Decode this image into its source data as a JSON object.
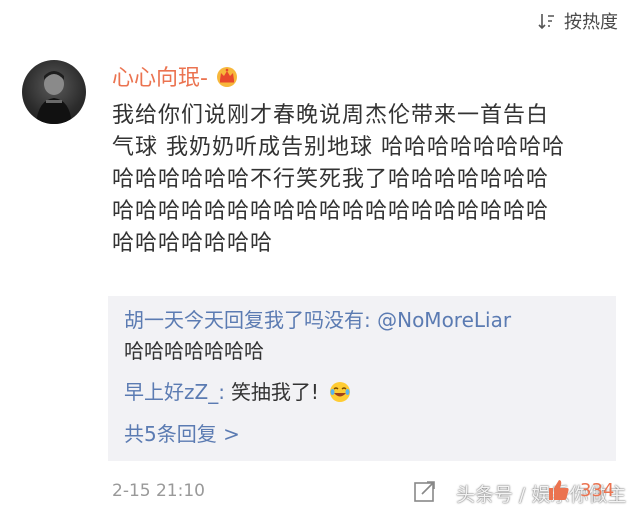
{
  "sort": {
    "label": "按热度",
    "icon": "sort-icon"
  },
  "comment": {
    "username": "心心向珉-",
    "badge_icon": "crown-icon",
    "avatar": "avatar",
    "text_lines": [
      "我给你们说刚才春晚说周杰伦带来一首告白",
      "气球 我奶奶听成告别地球 哈哈哈哈哈哈哈哈",
      "哈哈哈哈哈哈不行笑死我了哈哈哈哈哈哈哈",
      "哈哈哈哈哈哈哈哈哈哈哈哈哈哈哈哈哈哈哈",
      "哈哈哈哈哈哈哈"
    ],
    "timestamp": "2-15 21:10",
    "likes": "334"
  },
  "replies": {
    "reply1_user": "胡一天今天回复我了吗没有:",
    "reply1_mention": "@NoMoreLiar",
    "reply1_text": "哈哈哈哈哈哈哈",
    "reply2_user": "早上好zZ_:",
    "reply2_text": "笑抽我了!",
    "reply2_emoji": "laughing-tears-emoji-icon",
    "more_label": "共5条回复 >"
  },
  "watermark": "头条号 / 娱乐你做主",
  "colors": {
    "username": "#eb7350",
    "link": "#5b7bb2",
    "reply_bg": "#f2f2f5",
    "meta": "#999999"
  }
}
